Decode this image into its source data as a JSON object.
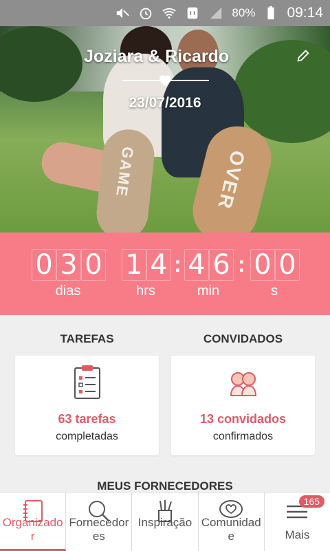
{
  "status_bar": {
    "battery": "80%",
    "time": "09:14",
    "icons": [
      "mute-icon",
      "alarm-icon",
      "wifi-icon",
      "nfc-icon",
      "signal-icon",
      "battery-icon"
    ]
  },
  "hero": {
    "couple_names": "Joziara & Ricardo",
    "date": "23/07/2016",
    "shoe_text_left": "GAME",
    "shoe_text_right": "OVER"
  },
  "countdown": {
    "days": [
      "0",
      "3",
      "0"
    ],
    "hours": [
      "1",
      "4"
    ],
    "minutes": [
      "4",
      "6"
    ],
    "seconds": [
      "0",
      "0"
    ],
    "labels": {
      "days": "dias",
      "hours": "hrs",
      "minutes": "min",
      "seconds": "s"
    },
    "separator": ":"
  },
  "cards": {
    "tasks": {
      "header": "TAREFAS",
      "count": "63 tarefas",
      "status": "completadas",
      "icon": "clipboard-icon"
    },
    "guests": {
      "header": "CONVIDADOS",
      "count": "13 convidados",
      "status": "confirmados",
      "icon": "couple-icon"
    }
  },
  "vendors_header": "MEUS FORNECEDORES",
  "nav": {
    "items": [
      {
        "label": "Organizador",
        "icon": "notebook-icon",
        "active": true
      },
      {
        "label": "Fornecedores",
        "icon": "search-icon"
      },
      {
        "label": "Inspiração",
        "icon": "brushes-icon"
      },
      {
        "label": "Comunidade",
        "icon": "heart-chat-icon"
      },
      {
        "label": "Mais",
        "icon": "menu-icon",
        "badge": "165"
      }
    ]
  },
  "colors": {
    "accent": "#f77c88",
    "accent_text": "#e05a66",
    "status_bar": "#8e8e8e"
  }
}
